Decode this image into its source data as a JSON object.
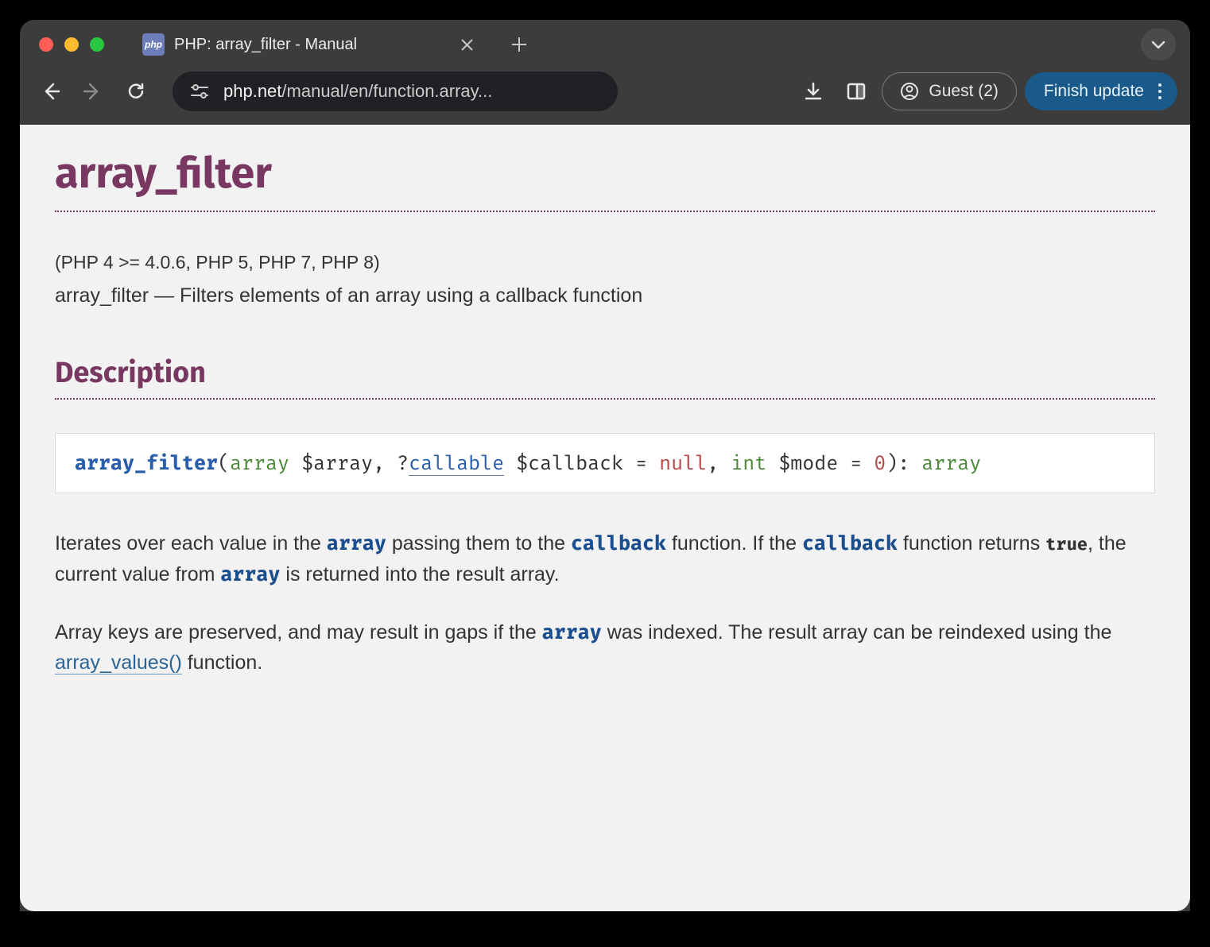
{
  "browser": {
    "tab_favicon_text": "php",
    "tab_title": "PHP: array_filter - Manual",
    "url_domain": "php.net",
    "url_path": "/manual/en/function.array...",
    "guest_label": "Guest (2)",
    "finish_update_label": "Finish update"
  },
  "page": {
    "title": "array_filter",
    "version": "(PHP 4 >= 4.0.6, PHP 5, PHP 7, PHP 8)",
    "summary_name": "array_filter",
    "summary_desc": "Filters elements of an array using a callback function",
    "section_description": "Description",
    "signature": {
      "fn": "array_filter",
      "p1_type": "array",
      "p1_var": "$array",
      "p2_prefix": "?",
      "p2_type": "callable",
      "p2_var": "$callback",
      "p2_default": "null",
      "p3_type": "int",
      "p3_var": "$mode",
      "p3_default": "0",
      "return_type": "array"
    },
    "para1": {
      "t1": "Iterates over each value in the ",
      "c1": "array",
      "t2": " passing them to the ",
      "c2": "callback",
      "t3": " function. If the ",
      "c3": "callback",
      "t4": " function returns ",
      "lit": "true",
      "t5": ", the current value from ",
      "c4": "array",
      "t6": " is returned into the result array."
    },
    "para2": {
      "t1": "Array keys are preserved, and may result in gaps if the ",
      "c1": "array",
      "t2": " was indexed. The result array can be reindexed using the ",
      "link": "array_values()",
      "t3": " function."
    }
  }
}
